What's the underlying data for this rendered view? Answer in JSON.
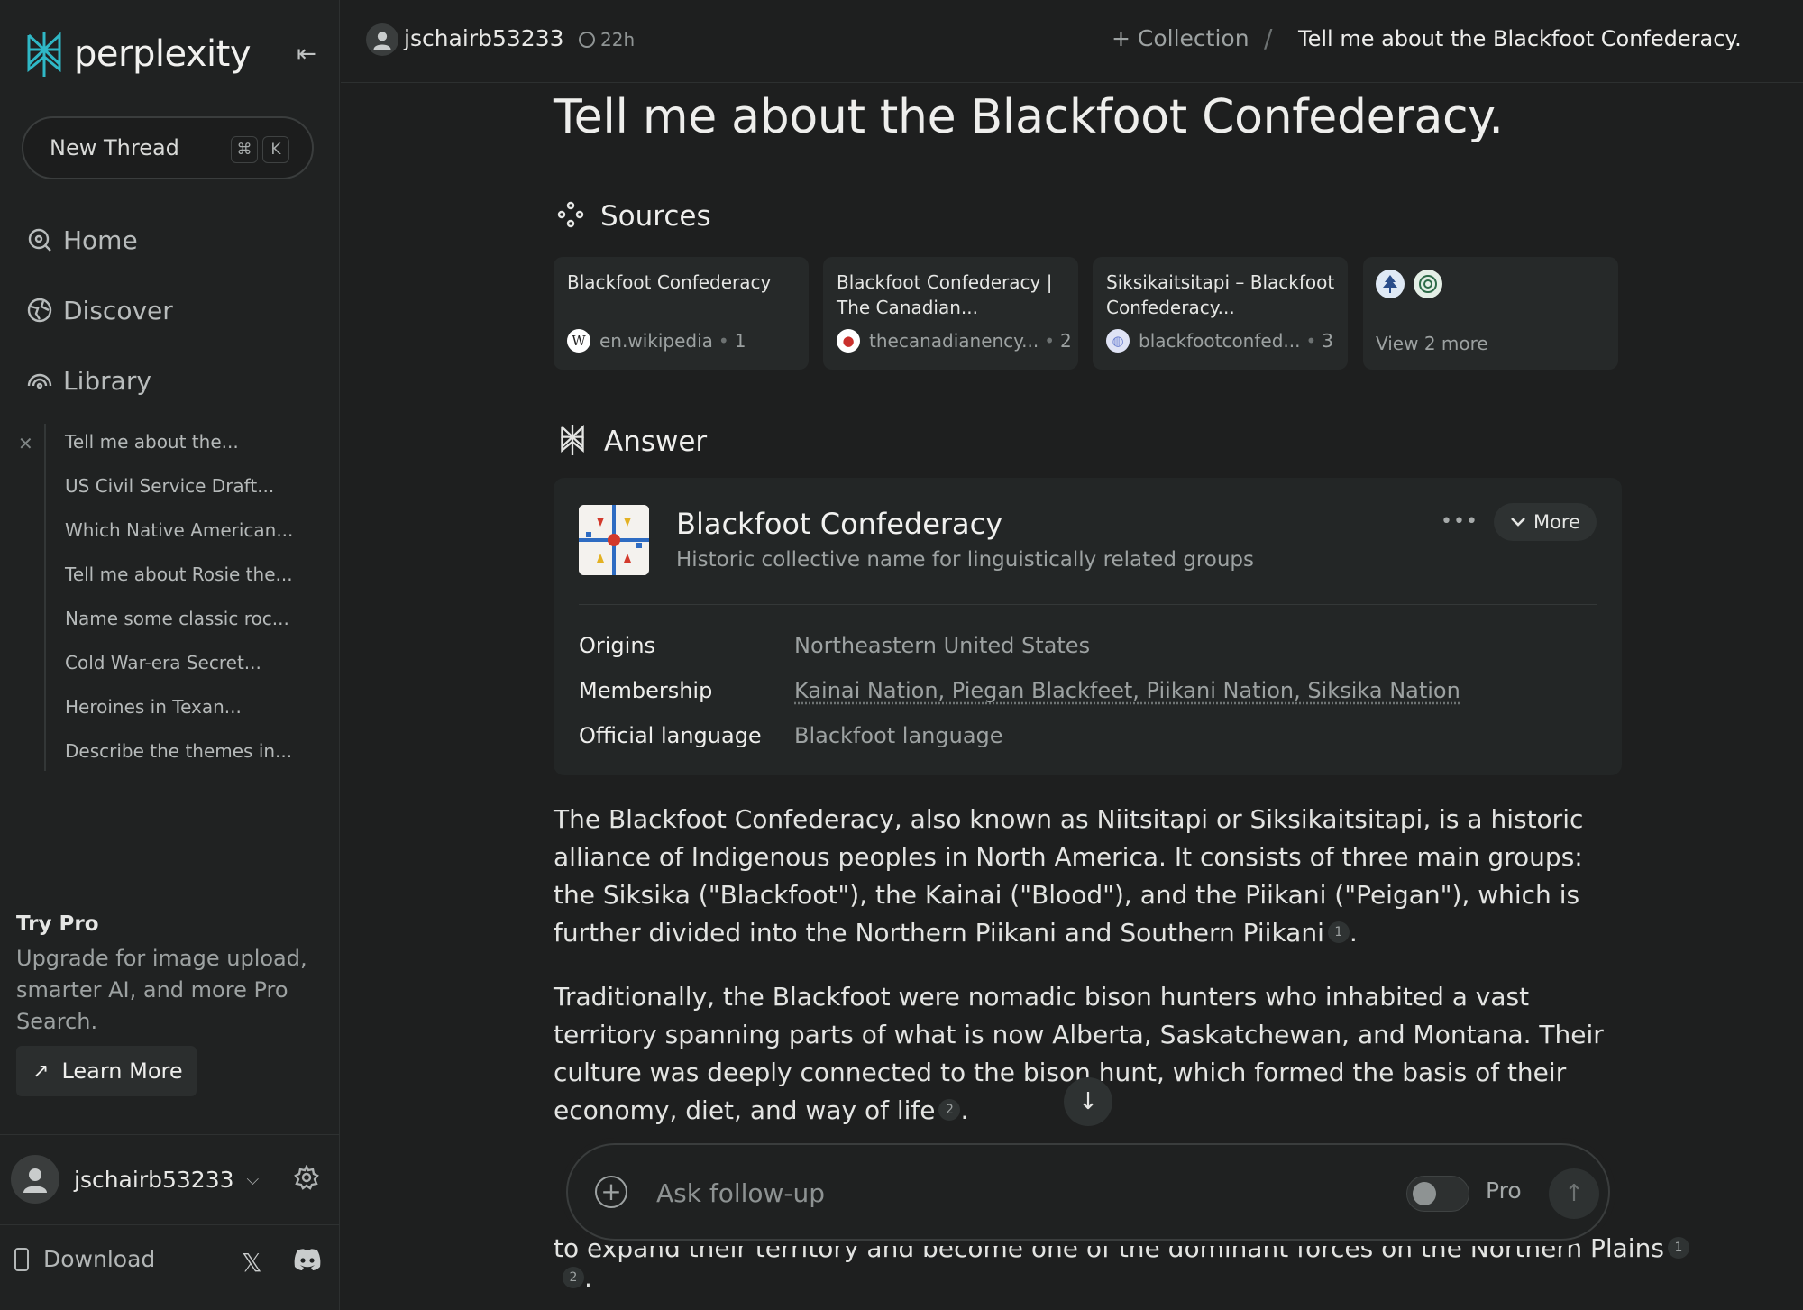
{
  "brand": {
    "name": "perplexity"
  },
  "sidebar": {
    "new_thread": "New Thread",
    "shortcut_cmd": "⌘",
    "shortcut_key": "K",
    "nav": [
      {
        "label": "Home",
        "icon": "home-search-icon"
      },
      {
        "label": "Discover",
        "icon": "globe-icon"
      },
      {
        "label": "Library",
        "icon": "library-icon"
      }
    ],
    "library_items": [
      "Tell me about the...",
      "US Civil Service Draft...",
      "Which Native American...",
      "Tell me about Rosie the...",
      "Name some classic roc...",
      "Cold War-era Secret...",
      "Heroines in Texan...",
      "Describe the themes in..."
    ],
    "try_pro": {
      "title": "Try Pro",
      "body": "Upgrade for image upload, smarter AI, and more Pro Search.",
      "button": "Learn More"
    },
    "user": {
      "name": "jschairb53233"
    },
    "download": "Download"
  },
  "topbar": {
    "user": "jschairb53233",
    "time": "22h",
    "collection": "+ Collection",
    "separator": "/",
    "thread_title": "Tell me about the Blackfoot Confederacy."
  },
  "main": {
    "title": "Tell me about the Blackfoot Confederacy.",
    "sources_label": "Sources",
    "sources": [
      {
        "title": "Blackfoot Confederacy",
        "domain": "en.wikipedia",
        "index": "1",
        "favicon": "wikipedia-icon",
        "favicon_glyph": "W",
        "favicon_color": "#ffffff"
      },
      {
        "title": "Blackfoot Confederacy | The Canadian...",
        "domain": "thecanadianency...",
        "index": "2",
        "favicon": "canadian-encyclopedia-icon",
        "favicon_glyph": "●",
        "favicon_color": "#c9302c"
      },
      {
        "title": "Siksikaitsitapi – Blackfoot Confederacy...",
        "domain": "blackfootconfed...",
        "index": "3",
        "favicon": "globe-icon",
        "favicon_glyph": "◍",
        "favicon_color": "#7a8fd6"
      }
    ],
    "view_more": "View 2 more",
    "answer_label": "Answer",
    "knowledge_panel": {
      "name": "Blackfoot Confederacy",
      "description": "Historic collective name for linguistically related groups",
      "more": "More",
      "rows": [
        {
          "key": "Origins",
          "value": "Northeastern United States"
        },
        {
          "key": "Membership",
          "value": "Kainai Nation, Piegan Blackfeet, Piikani Nation, Siksika Nation"
        },
        {
          "key": "Official language",
          "value": "Blackfoot language"
        }
      ]
    },
    "paragraphs": [
      {
        "text": "The Blackfoot Confederacy, also known as Niitsitapi or Siksikaitsitapi, is a historic alliance of Indigenous peoples in North America. It consists of three main groups: the Siksika (\"Blackfoot\"), the Kainai (\"Blood\"), and the Piikani (\"Peigan\"), which is further divided into the Northern Piikani and Southern Piikani",
        "cite": "1"
      },
      {
        "text": "Traditionally, the Blackfoot were nomadic bison hunters who inhabited a vast territory spanning parts of what is now Alberta, Saskatchewan, and Montana. Their culture was deeply connected to the bison hunt, which formed the basis of their economy, diet, and way of life",
        "cite": "2"
      }
    ],
    "partial_text": "to expand their territory and become one of the dominant forces on the Northern Plains",
    "partial_cite_1": "1",
    "partial_cite_2": "2"
  },
  "followup": {
    "placeholder": "Ask follow-up",
    "pro_label": "Pro",
    "pro_enabled": false
  }
}
